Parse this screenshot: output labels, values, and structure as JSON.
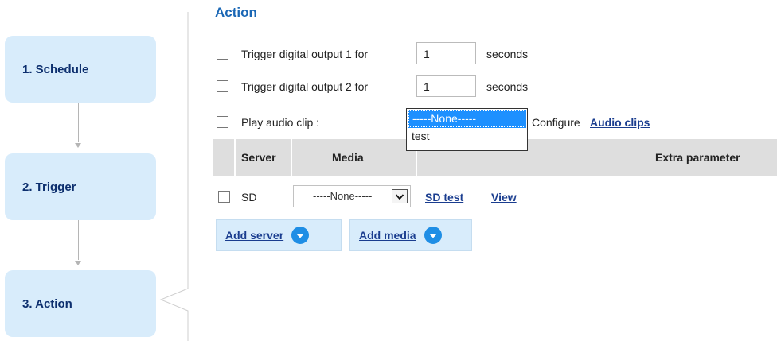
{
  "steps": [
    {
      "label": "1. Schedule"
    },
    {
      "label": "2. Trigger"
    },
    {
      "label": "3. Action"
    }
  ],
  "action": {
    "legend": "Action",
    "output1": {
      "label": "Trigger digital output 1 for",
      "value": "1",
      "unit": "seconds"
    },
    "output2": {
      "label": "Trigger digital output 2 for",
      "value": "1",
      "unit": "seconds"
    },
    "audio": {
      "label": "Play audio clip :",
      "options": [
        "-----None-----",
        "test"
      ],
      "selected": "-----None-----",
      "configure_text": "Configure",
      "configure_link": "Audio clips"
    },
    "table": {
      "headers": [
        "Server",
        "Media",
        "Extra parameter"
      ],
      "rows": [
        {
          "server": "SD",
          "media": "-----None-----",
          "link1": "SD test",
          "link2": "View"
        }
      ]
    },
    "buttons": {
      "add_server": "Add server",
      "add_media": "Add media"
    }
  },
  "colors": {
    "step_bg": "#d8ecfb",
    "legend": "#1a67b5",
    "link": "#1a3d8f",
    "selection": "#1e90ff",
    "table_header": "#dedede",
    "add_icon": "#1f8ee5"
  },
  "icons": {
    "add": "chevron-down-circle-icon",
    "select": "chevron-down-icon"
  }
}
